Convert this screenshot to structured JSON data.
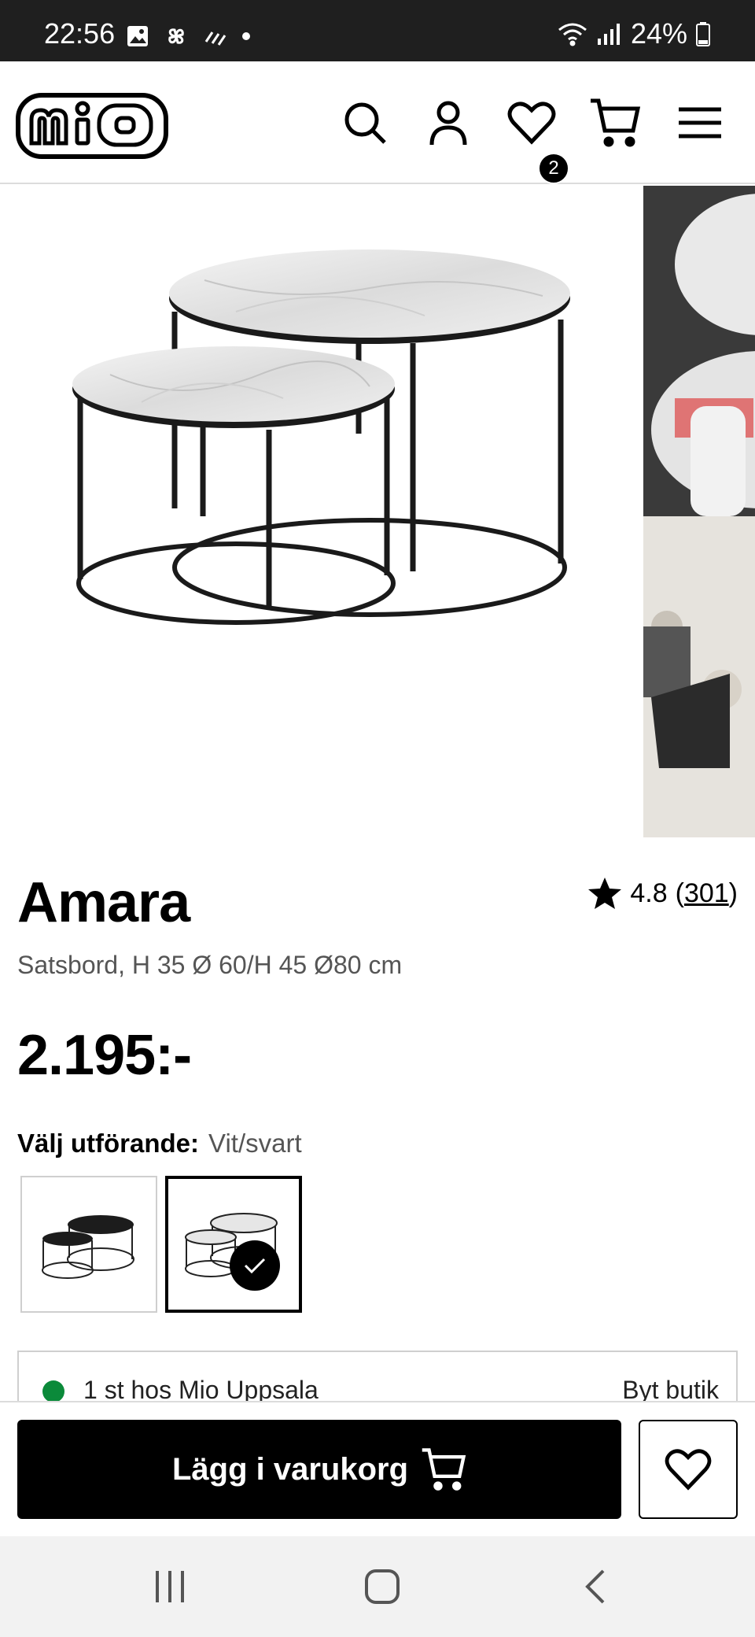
{
  "status_bar": {
    "time": "22:56",
    "battery": "24%",
    "icons": [
      "image-icon",
      "pinwheel-icon",
      "signal-lines-icon",
      "dot-icon",
      "wifi-icon",
      "cellular-icon",
      "battery-icon"
    ]
  },
  "header": {
    "logo": "mio",
    "icons": [
      "search-icon",
      "account-icon",
      "heart-icon",
      "cart-icon",
      "menu-icon"
    ],
    "wishlist_count": "2"
  },
  "product": {
    "name": "Amara",
    "rating": "4.8",
    "review_count_open": "(",
    "review_count": "301",
    "review_count_close": ")",
    "description": "Satsbord, H 35 Ø 60/H 45 Ø80 cm",
    "price": "2.195:-",
    "variant_label": "Välj utförande:",
    "variant_value": "Vit/svart",
    "variants": [
      {
        "name": "Svart",
        "selected": false
      },
      {
        "name": "Vit/svart",
        "selected": true
      }
    ]
  },
  "store": {
    "availability": "1 st hos Mio Uppsala",
    "change_label": "Byt butik",
    "status_color": "#0b8a3a"
  },
  "actions": {
    "add_to_cart": "Lägg i varukorg"
  },
  "navbar": {
    "icons": [
      "recent-apps-icon",
      "home-icon",
      "back-icon"
    ]
  }
}
